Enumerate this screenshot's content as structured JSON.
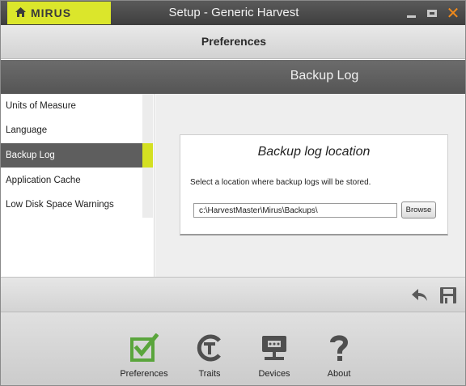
{
  "app": {
    "brand": "MIRUS",
    "window_title": "Setup - Generic Harvest",
    "close_glyph": "✕"
  },
  "section": {
    "title": "Preferences"
  },
  "page": {
    "title": "Backup Log"
  },
  "sidebar": {
    "items": [
      {
        "label": "Units of Measure"
      },
      {
        "label": "Language"
      },
      {
        "label": "Backup Log"
      },
      {
        "label": "Application Cache"
      },
      {
        "label": "Low Disk Space Warnings"
      }
    ],
    "selected_index": 2
  },
  "backup": {
    "heading": "Backup log location",
    "description": "Select a location where backup logs will be stored.",
    "path_value": "c:\\HarvestMaster\\Mirus\\Backups\\",
    "browse_label": "Browse"
  },
  "bottom_nav": {
    "tabs": [
      {
        "label": "Preferences",
        "icon": "checkbox-icon"
      },
      {
        "label": "Traits",
        "icon": "traits-icon"
      },
      {
        "label": "Devices",
        "icon": "devices-icon"
      },
      {
        "label": "About",
        "icon": "question-icon"
      }
    ]
  },
  "colors": {
    "accent": "#d4e021",
    "checkbox_green": "#5aa53c",
    "close_orange": "#f28a1a",
    "dark_bar": "#5e5e5e"
  }
}
